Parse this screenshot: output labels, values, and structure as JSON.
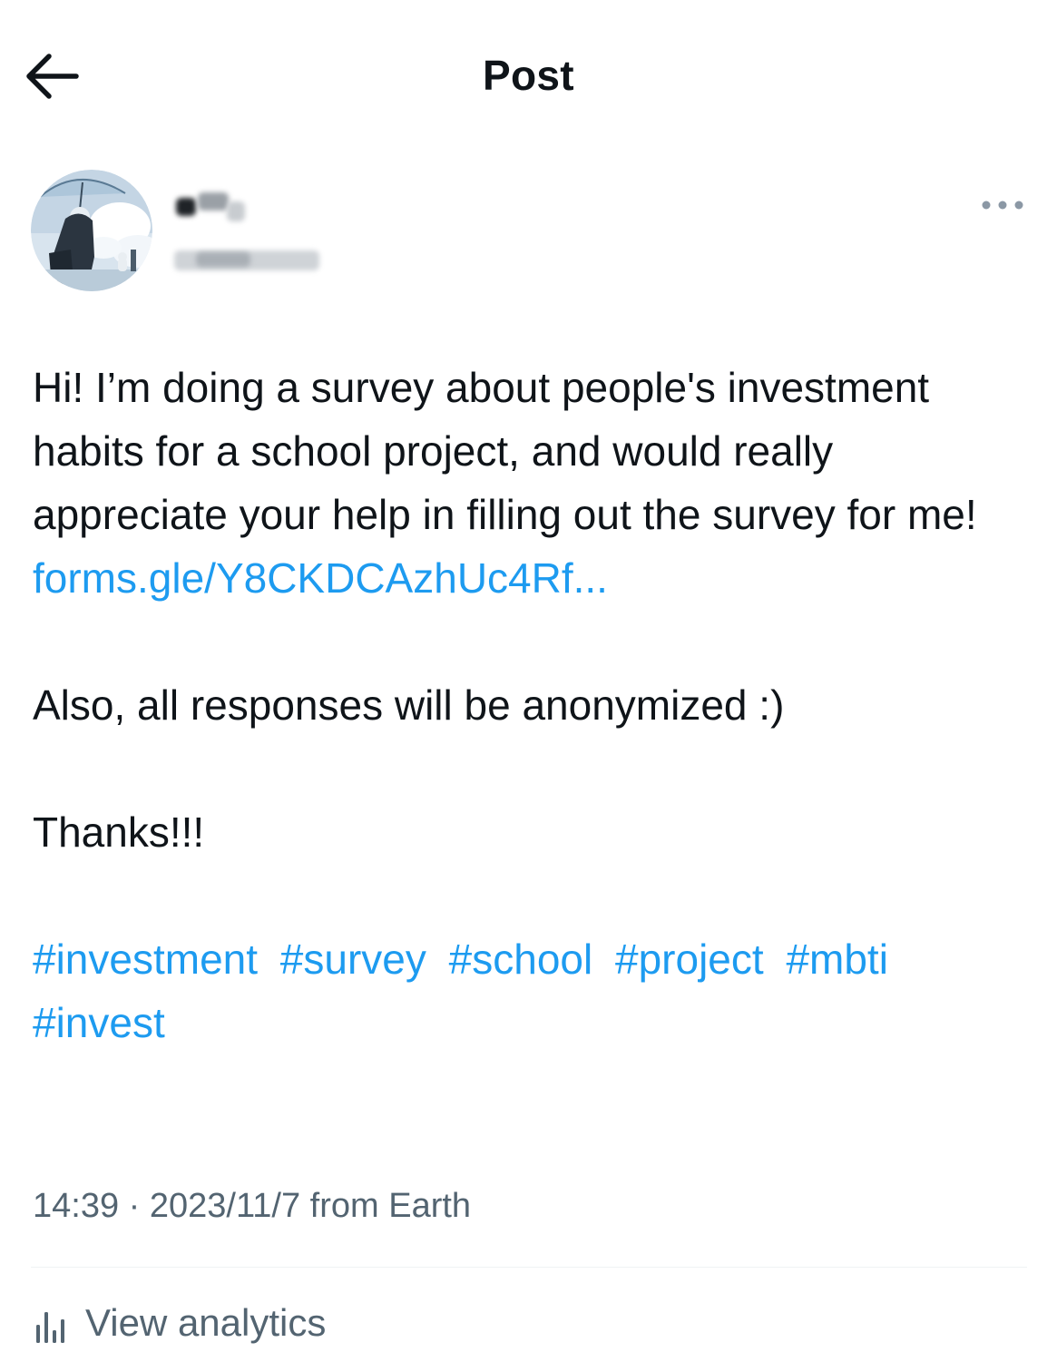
{
  "header": {
    "title": "Post",
    "back_icon": "arrow-left-icon"
  },
  "author": {
    "avatar_icon": "avatar-illustration",
    "display_name_redacted": true,
    "username_redacted": true,
    "more_icon": "more-horizontal-icon"
  },
  "tweet": {
    "paragraph1": "Hi! I’m doing a survey about people's investment habits for a school project, and would really appreciate your help in filling out the survey for me!",
    "link": "forms.gle/Y8CKDCAzhUc4Rf...",
    "paragraph2": "Also, all responses will be anonymized :)",
    "paragraph3": "Thanks!!!",
    "hashtags": [
      "#investment",
      "#survey",
      "#school",
      "#project",
      "#mbti",
      "#invest"
    ]
  },
  "meta": {
    "time": "14:39",
    "separator": "·",
    "date": "2023/11/7",
    "source": "from Earth"
  },
  "analytics": {
    "label": "View analytics",
    "icon": "analytics-bars-icon"
  },
  "colors": {
    "text": "#0f1419",
    "secondary": "#536471",
    "link": "#1d9bf0",
    "divider": "#eff3f4"
  }
}
